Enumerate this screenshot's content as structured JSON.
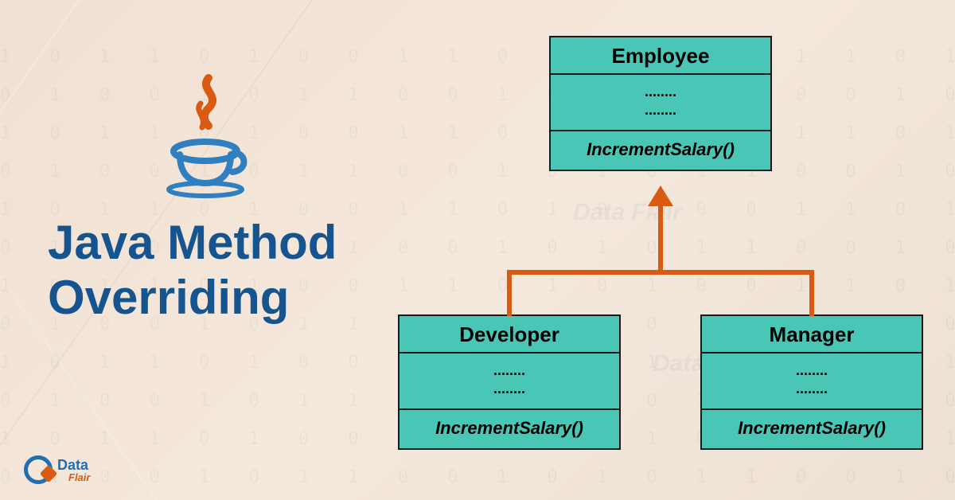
{
  "title_line1": "Java Method",
  "title_line2": "Overriding",
  "brand": {
    "line1": "Data",
    "line2": "Flair"
  },
  "uml": {
    "parent": {
      "name": "Employee",
      "attr1": "........",
      "attr2": "........",
      "method": "IncrementSalary()"
    },
    "child_left": {
      "name": "Developer",
      "attr1": "........",
      "attr2": "........",
      "method": "IncrementSalary()"
    },
    "child_right": {
      "name": "Manager",
      "attr1": "........",
      "attr2": "........",
      "method": "IncrementSalary()"
    }
  },
  "colors": {
    "brand_blue": "#16548f",
    "accent_orange": "#d95b13",
    "box_fill": "#49c6b6"
  }
}
